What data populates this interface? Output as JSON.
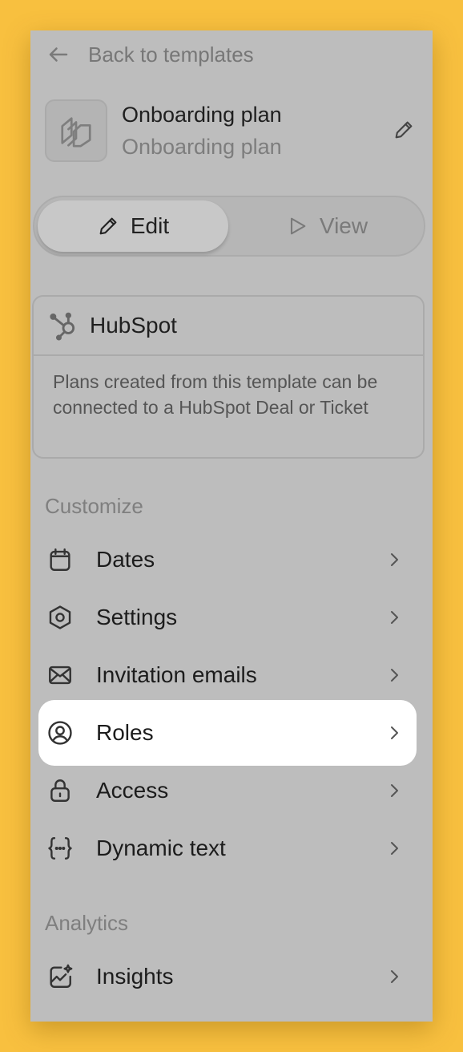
{
  "nav": {
    "back_label": "Back to templates"
  },
  "template": {
    "title": "Onboarding plan",
    "subtitle": "Onboarding plan"
  },
  "mode_toggle": {
    "edit_label": "Edit",
    "view_label": "View",
    "selected": "Edit"
  },
  "integration": {
    "title": "HubSpot",
    "description": "Plans created from this template can be connected to a HubSpot Deal or Ticket"
  },
  "customize": {
    "heading": "Customize",
    "items": [
      {
        "label": "Dates",
        "icon": "calendar-icon"
      },
      {
        "label": "Settings",
        "icon": "settings-hexagon-icon"
      },
      {
        "label": "Invitation emails",
        "icon": "envelope-icon"
      },
      {
        "label": "Roles",
        "icon": "user-circle-icon",
        "active": true
      },
      {
        "label": "Access",
        "icon": "lock-icon"
      },
      {
        "label": "Dynamic text",
        "icon": "braces-icon"
      }
    ]
  },
  "analytics": {
    "heading": "Analytics",
    "items": [
      {
        "label": "Insights",
        "icon": "insights-chart-icon"
      }
    ]
  },
  "colors": {
    "background": "#f8c03f",
    "panel": "#bdbdbd",
    "active_item": "#ffffff"
  }
}
